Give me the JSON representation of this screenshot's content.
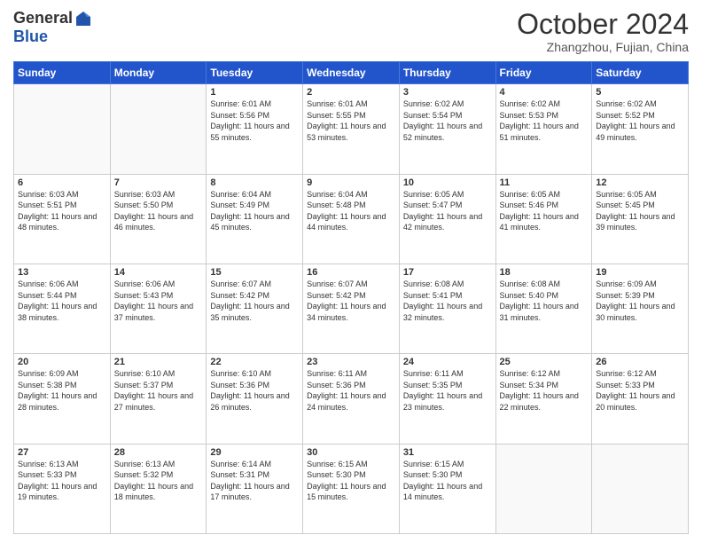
{
  "header": {
    "logo_general": "General",
    "logo_blue": "Blue",
    "month_title": "October 2024",
    "subtitle": "Zhangzhou, Fujian, China"
  },
  "days_of_week": [
    "Sunday",
    "Monday",
    "Tuesday",
    "Wednesday",
    "Thursday",
    "Friday",
    "Saturday"
  ],
  "weeks": [
    [
      {
        "day": "",
        "sunrise": "",
        "sunset": "",
        "daylight": "",
        "empty": true
      },
      {
        "day": "",
        "sunrise": "",
        "sunset": "",
        "daylight": "",
        "empty": true
      },
      {
        "day": "1",
        "sunrise": "Sunrise: 6:01 AM",
        "sunset": "Sunset: 5:56 PM",
        "daylight": "Daylight: 11 hours and 55 minutes."
      },
      {
        "day": "2",
        "sunrise": "Sunrise: 6:01 AM",
        "sunset": "Sunset: 5:55 PM",
        "daylight": "Daylight: 11 hours and 53 minutes."
      },
      {
        "day": "3",
        "sunrise": "Sunrise: 6:02 AM",
        "sunset": "Sunset: 5:54 PM",
        "daylight": "Daylight: 11 hours and 52 minutes."
      },
      {
        "day": "4",
        "sunrise": "Sunrise: 6:02 AM",
        "sunset": "Sunset: 5:53 PM",
        "daylight": "Daylight: 11 hours and 51 minutes."
      },
      {
        "day": "5",
        "sunrise": "Sunrise: 6:02 AM",
        "sunset": "Sunset: 5:52 PM",
        "daylight": "Daylight: 11 hours and 49 minutes."
      }
    ],
    [
      {
        "day": "6",
        "sunrise": "Sunrise: 6:03 AM",
        "sunset": "Sunset: 5:51 PM",
        "daylight": "Daylight: 11 hours and 48 minutes."
      },
      {
        "day": "7",
        "sunrise": "Sunrise: 6:03 AM",
        "sunset": "Sunset: 5:50 PM",
        "daylight": "Daylight: 11 hours and 46 minutes."
      },
      {
        "day": "8",
        "sunrise": "Sunrise: 6:04 AM",
        "sunset": "Sunset: 5:49 PM",
        "daylight": "Daylight: 11 hours and 45 minutes."
      },
      {
        "day": "9",
        "sunrise": "Sunrise: 6:04 AM",
        "sunset": "Sunset: 5:48 PM",
        "daylight": "Daylight: 11 hours and 44 minutes."
      },
      {
        "day": "10",
        "sunrise": "Sunrise: 6:05 AM",
        "sunset": "Sunset: 5:47 PM",
        "daylight": "Daylight: 11 hours and 42 minutes."
      },
      {
        "day": "11",
        "sunrise": "Sunrise: 6:05 AM",
        "sunset": "Sunset: 5:46 PM",
        "daylight": "Daylight: 11 hours and 41 minutes."
      },
      {
        "day": "12",
        "sunrise": "Sunrise: 6:05 AM",
        "sunset": "Sunset: 5:45 PM",
        "daylight": "Daylight: 11 hours and 39 minutes."
      }
    ],
    [
      {
        "day": "13",
        "sunrise": "Sunrise: 6:06 AM",
        "sunset": "Sunset: 5:44 PM",
        "daylight": "Daylight: 11 hours and 38 minutes."
      },
      {
        "day": "14",
        "sunrise": "Sunrise: 6:06 AM",
        "sunset": "Sunset: 5:43 PM",
        "daylight": "Daylight: 11 hours and 37 minutes."
      },
      {
        "day": "15",
        "sunrise": "Sunrise: 6:07 AM",
        "sunset": "Sunset: 5:42 PM",
        "daylight": "Daylight: 11 hours and 35 minutes."
      },
      {
        "day": "16",
        "sunrise": "Sunrise: 6:07 AM",
        "sunset": "Sunset: 5:42 PM",
        "daylight": "Daylight: 11 hours and 34 minutes."
      },
      {
        "day": "17",
        "sunrise": "Sunrise: 6:08 AM",
        "sunset": "Sunset: 5:41 PM",
        "daylight": "Daylight: 11 hours and 32 minutes."
      },
      {
        "day": "18",
        "sunrise": "Sunrise: 6:08 AM",
        "sunset": "Sunset: 5:40 PM",
        "daylight": "Daylight: 11 hours and 31 minutes."
      },
      {
        "day": "19",
        "sunrise": "Sunrise: 6:09 AM",
        "sunset": "Sunset: 5:39 PM",
        "daylight": "Daylight: 11 hours and 30 minutes."
      }
    ],
    [
      {
        "day": "20",
        "sunrise": "Sunrise: 6:09 AM",
        "sunset": "Sunset: 5:38 PM",
        "daylight": "Daylight: 11 hours and 28 minutes."
      },
      {
        "day": "21",
        "sunrise": "Sunrise: 6:10 AM",
        "sunset": "Sunset: 5:37 PM",
        "daylight": "Daylight: 11 hours and 27 minutes."
      },
      {
        "day": "22",
        "sunrise": "Sunrise: 6:10 AM",
        "sunset": "Sunset: 5:36 PM",
        "daylight": "Daylight: 11 hours and 26 minutes."
      },
      {
        "day": "23",
        "sunrise": "Sunrise: 6:11 AM",
        "sunset": "Sunset: 5:36 PM",
        "daylight": "Daylight: 11 hours and 24 minutes."
      },
      {
        "day": "24",
        "sunrise": "Sunrise: 6:11 AM",
        "sunset": "Sunset: 5:35 PM",
        "daylight": "Daylight: 11 hours and 23 minutes."
      },
      {
        "day": "25",
        "sunrise": "Sunrise: 6:12 AM",
        "sunset": "Sunset: 5:34 PM",
        "daylight": "Daylight: 11 hours and 22 minutes."
      },
      {
        "day": "26",
        "sunrise": "Sunrise: 6:12 AM",
        "sunset": "Sunset: 5:33 PM",
        "daylight": "Daylight: 11 hours and 20 minutes."
      }
    ],
    [
      {
        "day": "27",
        "sunrise": "Sunrise: 6:13 AM",
        "sunset": "Sunset: 5:33 PM",
        "daylight": "Daylight: 11 hours and 19 minutes."
      },
      {
        "day": "28",
        "sunrise": "Sunrise: 6:13 AM",
        "sunset": "Sunset: 5:32 PM",
        "daylight": "Daylight: 11 hours and 18 minutes."
      },
      {
        "day": "29",
        "sunrise": "Sunrise: 6:14 AM",
        "sunset": "Sunset: 5:31 PM",
        "daylight": "Daylight: 11 hours and 17 minutes."
      },
      {
        "day": "30",
        "sunrise": "Sunrise: 6:15 AM",
        "sunset": "Sunset: 5:30 PM",
        "daylight": "Daylight: 11 hours and 15 minutes."
      },
      {
        "day": "31",
        "sunrise": "Sunrise: 6:15 AM",
        "sunset": "Sunset: 5:30 PM",
        "daylight": "Daylight: 11 hours and 14 minutes."
      },
      {
        "day": "",
        "sunrise": "",
        "sunset": "",
        "daylight": "",
        "empty": true
      },
      {
        "day": "",
        "sunrise": "",
        "sunset": "",
        "daylight": "",
        "empty": true
      }
    ]
  ]
}
